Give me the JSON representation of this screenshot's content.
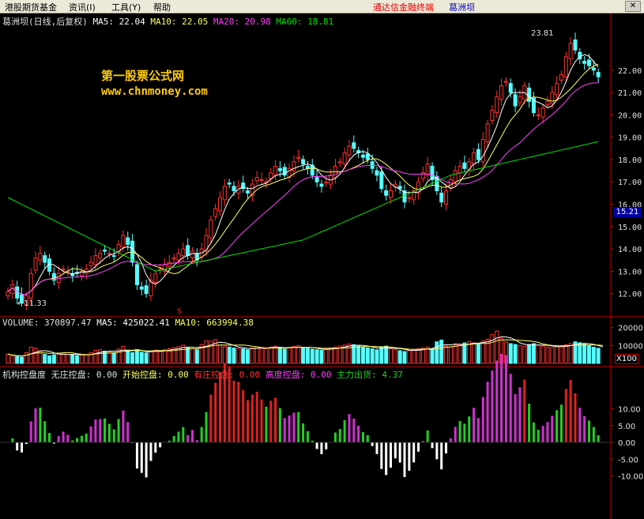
{
  "menu": {
    "items": [
      "港股期货基金",
      "资讯(I)",
      "工具(Y)",
      "帮助"
    ],
    "center_title": "通达信金融终端",
    "stock_name": "葛洲坝",
    "close": "✕"
  },
  "price_panel": {
    "title": "葛洲坝(日线,后复权)",
    "ma5_label": "MA5: 22.04",
    "ma10_label": "MA10: 22.05",
    "ma20_label": "MA20: 20.98",
    "ma60_label": "MA60: 18.81",
    "high_label": "23.81",
    "low_label": "11.33",
    "current_price": "15.21",
    "y_ticks": [
      "22.00",
      "21.00",
      "20.00",
      "19.00",
      "18.00",
      "17.00",
      "16.00",
      "15.00",
      "14.00",
      "13.00",
      "12.00"
    ],
    "watermark_cn": "第一股票公式网",
    "watermark_url": "www.chnmoney.com",
    "marker": "S"
  },
  "volume_panel": {
    "vol_label": "VOLUME: 370897.47",
    "ma5_label": "MA5: 425022.41",
    "ma10_label": "MA10: 663994.38",
    "y_ticks": [
      "20000",
      "10000"
    ],
    "unit": "X100"
  },
  "indicator_panel": {
    "name": "机构控盘度",
    "labels": [
      "无庄控盘: 0.00",
      "开始控盘: 0.00",
      "有庄控盘: 0.00",
      "高度控盘: 0.00",
      "主力出货: 4.37"
    ],
    "y_ticks": [
      "10.00",
      "5.00",
      "0.00",
      "-5.00",
      "-10.00"
    ]
  },
  "colors": {
    "up": "#ff3030",
    "down": "#54ffff",
    "ma5": "#ffffff",
    "ma10": "#ffff60",
    "ma20": "#ff40ff",
    "ma60": "#00e000",
    "axis": "#c00000",
    "green_bar": "#20d020",
    "magenta_bar": "#d030d0",
    "red_bar": "#e02020",
    "white_bar": "#ffffff"
  },
  "chart_data": {
    "type": "candlestick",
    "y_range": [
      11.0,
      23.9
    ],
    "close": [
      12.1,
      12.4,
      11.8,
      11.6,
      11.9,
      12.9,
      13.6,
      13.8,
      13.4,
      13.0,
      12.6,
      12.9,
      13.1,
      13.0,
      12.8,
      12.9,
      13.0,
      13.1,
      13.4,
      13.7,
      13.8,
      13.9,
      13.8,
      13.7,
      14.2,
      14.6,
      14.2,
      13.4,
      12.4,
      12.2,
      12.0,
      12.6,
      12.9,
      13.1,
      13.3,
      13.4,
      13.6,
      13.8,
      14.0,
      13.7,
      13.9,
      13.5,
      14.0,
      14.6,
      15.3,
      15.8,
      16.3,
      16.8,
      16.9,
      16.6,
      16.8,
      16.7,
      16.5,
      16.9,
      17.2,
      17.1,
      17.0,
      17.4,
      17.7,
      17.5,
      17.3,
      17.6,
      17.9,
      18.1,
      17.8,
      17.6,
      17.3,
      17.0,
      16.8,
      17.0,
      17.3,
      17.7,
      17.9,
      18.3,
      18.6,
      18.5,
      18.3,
      18.1,
      18.0,
      17.6,
      17.3,
      16.7,
      16.4,
      16.6,
      16.9,
      16.7,
      16.1,
      16.3,
      16.6,
      17.0,
      17.4,
      17.8,
      17.1,
      16.6,
      16.1,
      16.6,
      17.1,
      17.5,
      17.7,
      17.6,
      17.9,
      18.3,
      18.0,
      18.9,
      19.6,
      20.2,
      20.8,
      21.3,
      21.5,
      21.0,
      20.4,
      20.8,
      21.3,
      20.6,
      20.1,
      20.0,
      20.3,
      20.6,
      21.0,
      21.4,
      21.8,
      22.6,
      23.2,
      22.9,
      22.5,
      22.3,
      22.2,
      22.0,
      21.7
    ],
    "volume": [
      5200,
      4100,
      3800,
      3500,
      6000,
      9000,
      8500,
      7000,
      5000,
      4200,
      4800,
      5200,
      5600,
      5000,
      4600,
      4300,
      4700,
      5000,
      6000,
      7200,
      7600,
      6800,
      6400,
      6000,
      8000,
      9500,
      7000,
      6000,
      7600,
      6200,
      5800,
      6800,
      7400,
      7000,
      7600,
      8100,
      8800,
      9300,
      10200,
      8600,
      8200,
      7600,
      10500,
      12500,
      12400,
      13200,
      10100,
      9400,
      9100,
      8600,
      8300,
      8100,
      7600,
      8600,
      9200,
      8800,
      8100,
      9100,
      9600,
      8900,
      8000,
      8600,
      9400,
      9900,
      8700,
      8300,
      7900,
      7600,
      7300,
      8100,
      8600,
      9100,
      9600,
      10200,
      10800,
      10400,
      9600,
      9100,
      8600,
      8100,
      7600,
      8900,
      9600,
      8100,
      7600,
      7100,
      6600,
      7100,
      7600,
      8100,
      8600,
      9100,
      8100,
      12000,
      13000,
      9600,
      9100,
      10200,
      10800,
      11400,
      12200,
      11400,
      10600,
      12500,
      13500,
      16000,
      18000,
      14000,
      12000,
      11000,
      10500,
      10000,
      9500,
      10500,
      11000,
      10200,
      9600,
      9000,
      8800,
      9200,
      9800,
      10400,
      11000,
      12000,
      11500,
      10800,
      9800,
      9000,
      8400,
      7800
    ]
  }
}
